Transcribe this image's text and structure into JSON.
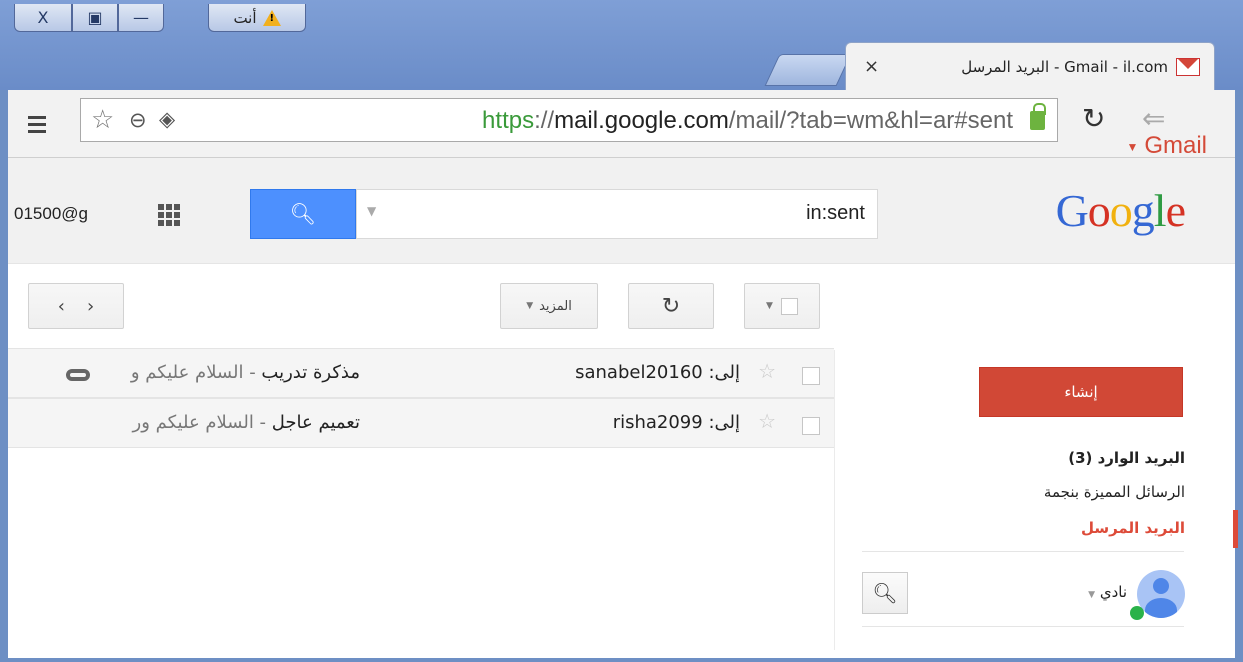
{
  "window": {
    "buttons": [
      "X",
      "▣",
      "—"
    ],
    "profile_label": "أنت"
  },
  "tab": {
    "title": "البريد المرسل - Gmail - il.com",
    "close": "×"
  },
  "toolbar": {
    "url_scheme": "https",
    "url_sep": "://",
    "url_host": "mail.google.com",
    "url_path": "/mail/?tab=wm&hl=ar#sent"
  },
  "header": {
    "account": "01500@g",
    "search_query": "in:sent",
    "logo": "Google"
  },
  "actions": {
    "more_label": "المزيد",
    "gmail_label": "Gmail"
  },
  "messages": [
    {
      "to": "إلى: sanabel20160",
      "subject": "مذكرة تدريب",
      "snippet": " - السلام عليكم و",
      "attachment": true
    },
    {
      "to": "إلى: risha2099",
      "subject": "تعميم عاجل",
      "snippet": " - السلام عليكم ور",
      "attachment": false
    }
  ],
  "sidebar": {
    "compose": "إنشاء",
    "inbox": "البريد الوارد (3)",
    "starred": "الرسائل المميزة بنجمة",
    "sent": "البريد المرسل",
    "user": "نادي"
  },
  "colors": {
    "accent": "#dd4b39",
    "search_blue": "#4d90fe"
  }
}
